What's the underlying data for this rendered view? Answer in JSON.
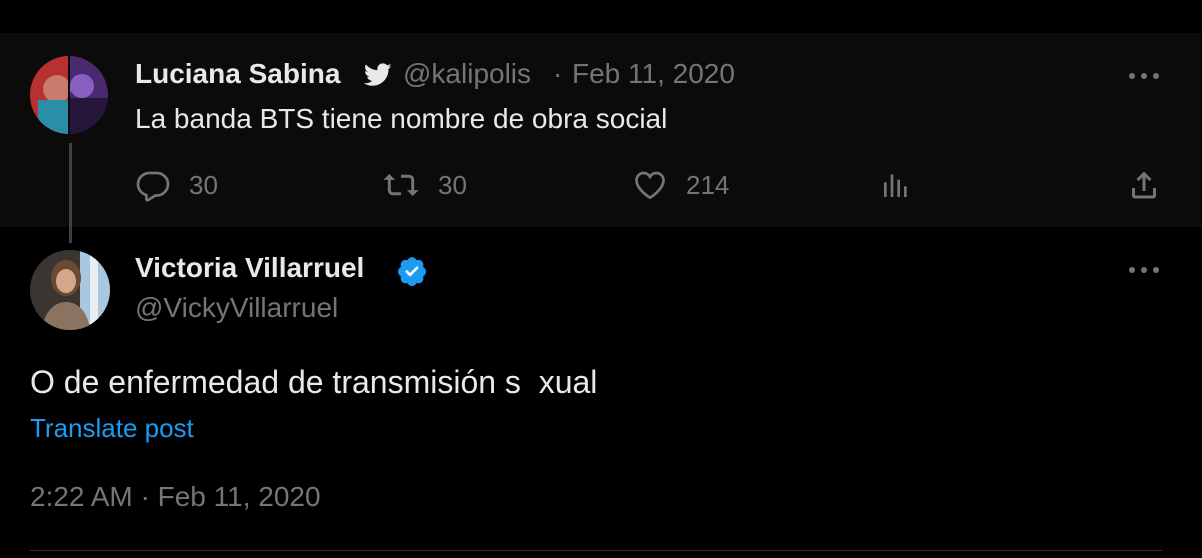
{
  "parent_tweet": {
    "author_name": "Luciana Sabina",
    "handle": "@kalipolis",
    "separator": "·",
    "date": "Feb 11, 2020",
    "text": "La banda BTS tiene nombre de obra social",
    "replies": "30",
    "retweets": "30",
    "likes": "214"
  },
  "main_tweet": {
    "author_name": "Victoria Villarruel",
    "handle": "@VickyVillarruel",
    "text": "O de enfermedad de transmisión s  xual",
    "translate_label": "Translate post",
    "timestamp": "2:22 AM · Feb 11, 2020"
  },
  "icons": {
    "bird": "bird-icon",
    "verified": "verified-badge-icon",
    "more": "more-icon",
    "reply": "reply-icon",
    "retweet": "retweet-icon",
    "like": "like-icon",
    "views": "views-icon",
    "share": "share-icon"
  },
  "colors": {
    "background": "#000000",
    "parent_background": "#0b0b0b",
    "text": "#e7e9ea",
    "muted": "#71767b",
    "link": "#1d9bf0",
    "verified": "#1d9bf0"
  }
}
